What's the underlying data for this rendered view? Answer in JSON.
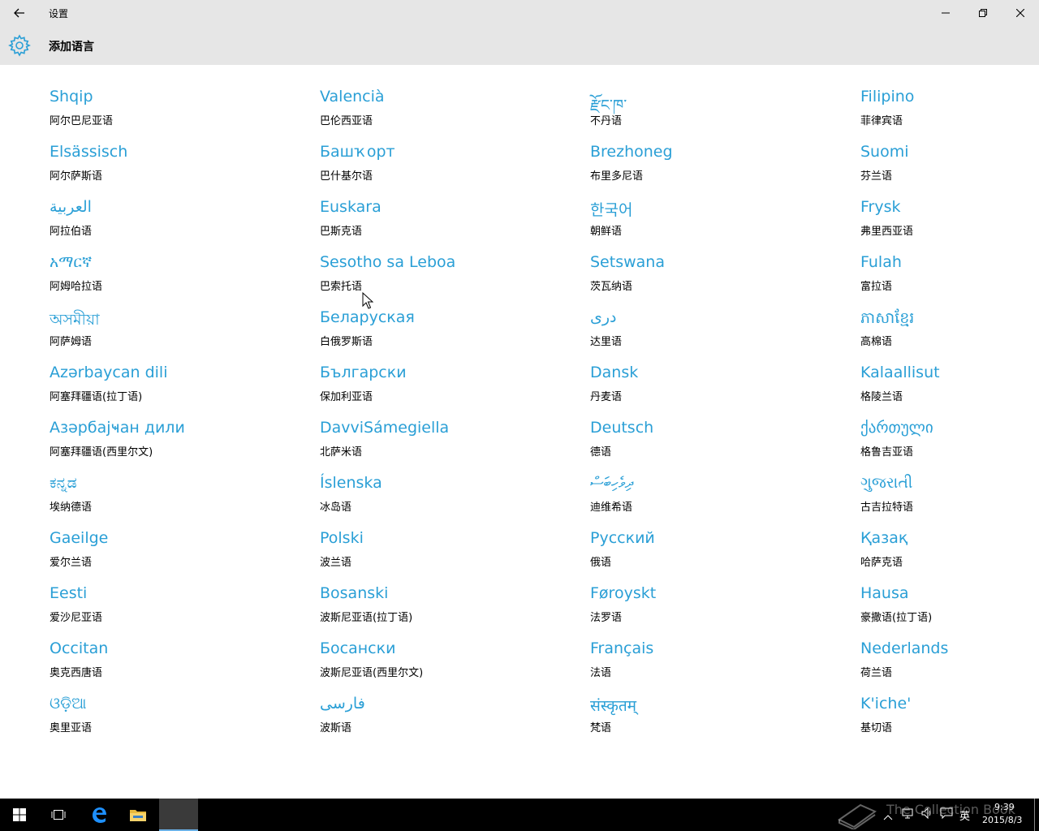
{
  "window": {
    "title": "设置"
  },
  "header": {
    "title": "添加语言"
  },
  "languages": [
    [
      {
        "native": "Shqip",
        "zh": "阿尔巴尼亚语"
      },
      {
        "native": "Elsässisch",
        "zh": "阿尔萨斯语"
      },
      {
        "native": "العربية",
        "zh": "阿拉伯语"
      },
      {
        "native": "አማርኛ",
        "zh": "阿姆哈拉语"
      },
      {
        "native": "অসমীয়া",
        "zh": "阿萨姆语"
      },
      {
        "native": "Azərbaycan dili",
        "zh": "阿塞拜疆语(拉丁语)"
      },
      {
        "native": "Азәрбајҹан дили",
        "zh": "阿塞拜疆语(西里尔文)"
      },
      {
        "native": "ಕನ್ನಡ",
        "zh": "埃纳德语"
      },
      {
        "native": "Gaeilge",
        "zh": "爱尔兰语"
      },
      {
        "native": "Eesti",
        "zh": "爱沙尼亚语"
      },
      {
        "native": "Occitan",
        "zh": "奥克西唐语"
      },
      {
        "native": "ଓଡ଼ିଆ",
        "zh": "奥里亚语"
      }
    ],
    [
      {
        "native": "Valencià",
        "zh": "巴伦西亚语"
      },
      {
        "native": "Башҡорт",
        "zh": "巴什基尔语"
      },
      {
        "native": "Euskara",
        "zh": "巴斯克语"
      },
      {
        "native": "Sesotho sa Leboa",
        "zh": "巴索托语"
      },
      {
        "native": "Беларуская",
        "zh": "白俄罗斯语"
      },
      {
        "native": "Български",
        "zh": "保加利亚语"
      },
      {
        "native": "DavviSámegiella",
        "zh": "北萨米语"
      },
      {
        "native": "Íslenska",
        "zh": "冰岛语"
      },
      {
        "native": "Polski",
        "zh": "波兰语"
      },
      {
        "native": "Bosanski",
        "zh": "波斯尼亚语(拉丁语)"
      },
      {
        "native": "Босански",
        "zh": "波斯尼亚语(西里尔文)"
      },
      {
        "native": "فارسى",
        "zh": "波斯语"
      }
    ],
    [
      {
        "native": "རྫོང་ཁ་",
        "zh": "不丹语"
      },
      {
        "native": "Brezhoneg",
        "zh": "布里多尼语"
      },
      {
        "native": "한국어",
        "zh": "朝鲜语"
      },
      {
        "native": "Setswana",
        "zh": "茨瓦纳语"
      },
      {
        "native": "درى",
        "zh": "达里语"
      },
      {
        "native": "Dansk",
        "zh": "丹麦语"
      },
      {
        "native": "Deutsch",
        "zh": "德语"
      },
      {
        "native": "ދިވެހިބަސް",
        "zh": "迪维希语"
      },
      {
        "native": "Русский",
        "zh": "俄语"
      },
      {
        "native": "Føroyskt",
        "zh": "法罗语"
      },
      {
        "native": "Français",
        "zh": "法语"
      },
      {
        "native": "संस्कृतम्",
        "zh": "梵语"
      }
    ],
    [
      {
        "native": "Filipino",
        "zh": "菲律宾语"
      },
      {
        "native": "Suomi",
        "zh": "芬兰语"
      },
      {
        "native": "Frysk",
        "zh": "弗里西亚语"
      },
      {
        "native": "Fulah",
        "zh": "富拉语"
      },
      {
        "native": "ភាសាខ្មែរ",
        "zh": "高棉语"
      },
      {
        "native": "Kalaallisut",
        "zh": "格陵兰语"
      },
      {
        "native": "ქართული",
        "zh": "格鲁吉亚语"
      },
      {
        "native": "ગુજરાતી",
        "zh": "古吉拉特语"
      },
      {
        "native": "Қазақ",
        "zh": "哈萨克语"
      },
      {
        "native": "Hausa",
        "zh": "豪撒语(拉丁语)"
      },
      {
        "native": "Nederlands",
        "zh": "荷兰语"
      },
      {
        "native": "K'iche'",
        "zh": "基切语"
      }
    ]
  ],
  "taskbar": {
    "ime": "英",
    "time": "9:39",
    "date": "2015/8/3",
    "watermark": "The Collection Book"
  },
  "colors": {
    "accent": "#2a9fd6",
    "chrome": "#e6e6e6",
    "taskbar": "#000000"
  }
}
